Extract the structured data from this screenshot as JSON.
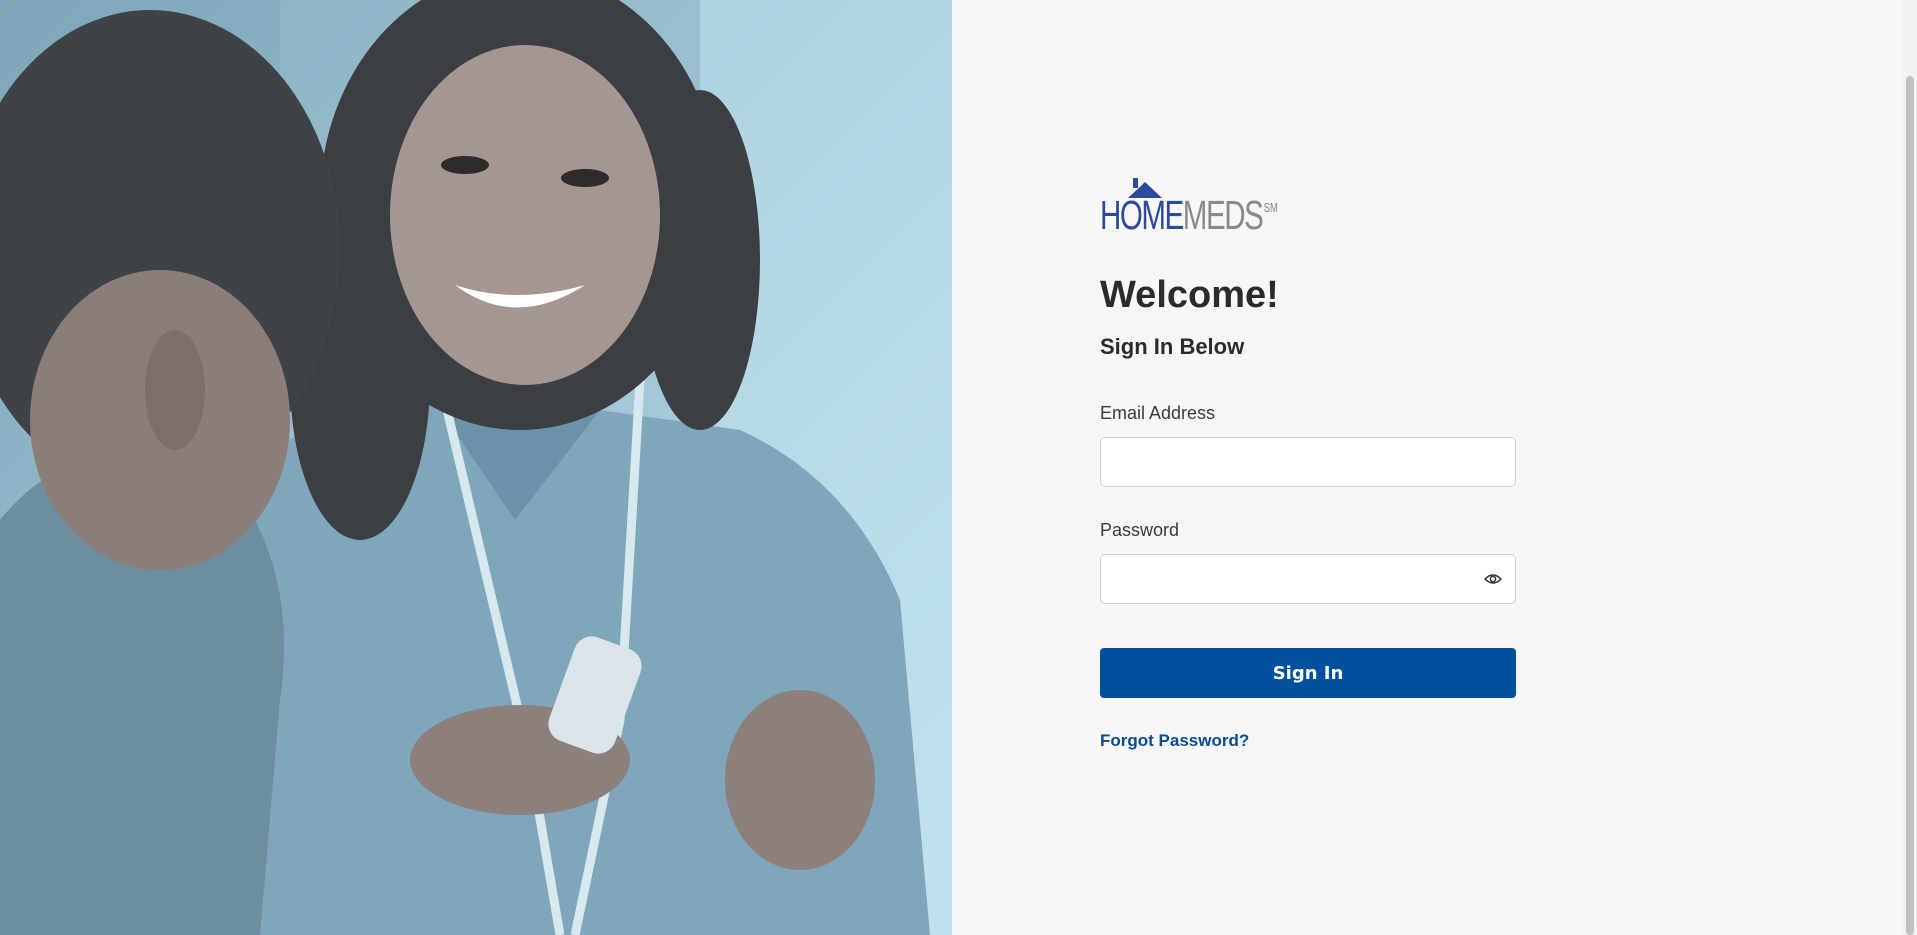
{
  "hero": {
    "image": "nurse-handing-medication-to-patient-photo"
  },
  "logo": {
    "home": "HOME",
    "meds": "MEDS",
    "sm": "SM",
    "colors": {
      "home": "#2e4a9a",
      "meds": "#8a8a8a"
    }
  },
  "welcome": "Welcome!",
  "subtitle": "Sign In Below",
  "email": {
    "label": "Email Address",
    "value": "",
    "placeholder": ""
  },
  "password": {
    "label": "Password",
    "value": "",
    "placeholder": "",
    "toggle_icon": "eye-icon"
  },
  "signin_label": "Sign In",
  "forgot_label": "Forgot Password?",
  "colors": {
    "primary": "#00509e",
    "link": "#0a4a8f",
    "background": "#f7f7f7",
    "text": "#2b2b2b"
  }
}
